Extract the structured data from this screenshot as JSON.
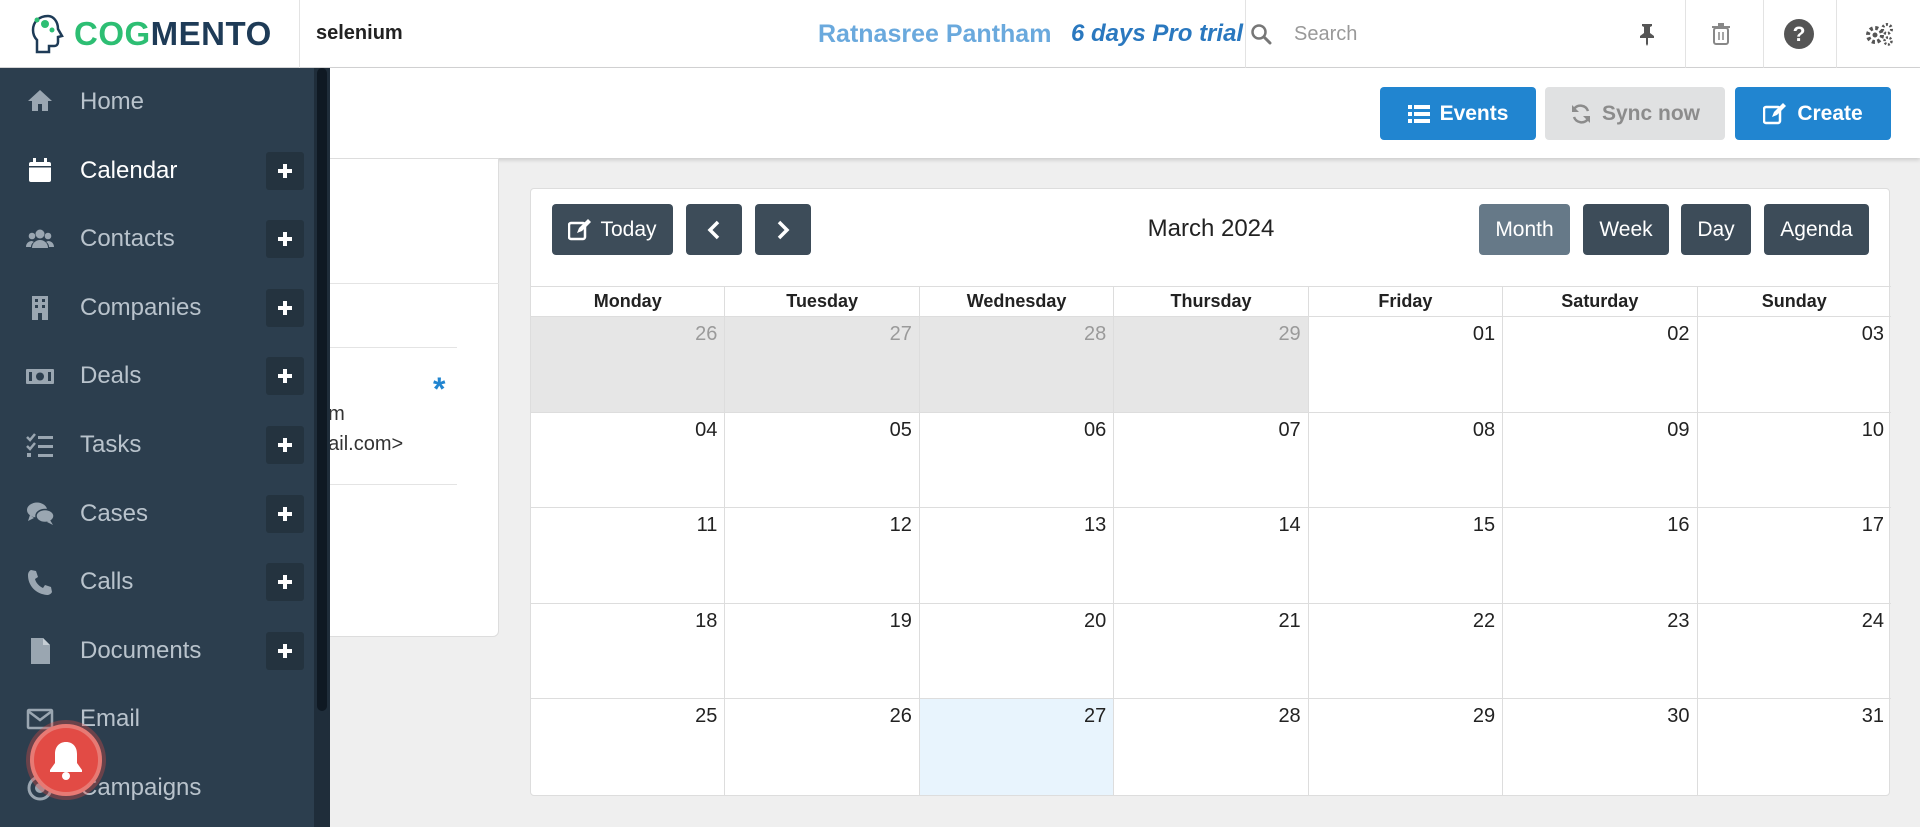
{
  "header": {
    "logo_cog": "COG",
    "logo_mento": "MENTO",
    "tenant": "selenium",
    "user_name": "Ratnasree Pantham",
    "trial": "6 days Pro trial",
    "search_placeholder": "Search",
    "icons": [
      "pin-icon",
      "trash-icon",
      "help-icon",
      "settings-icon"
    ]
  },
  "sidebar": {
    "items": [
      {
        "label": "Home",
        "icon": "home-icon",
        "has_plus": false,
        "active": false
      },
      {
        "label": "Calendar",
        "icon": "calendar-icon",
        "has_plus": true,
        "active": true
      },
      {
        "label": "Contacts",
        "icon": "users-icon",
        "has_plus": true,
        "active": false
      },
      {
        "label": "Companies",
        "icon": "building-icon",
        "has_plus": true,
        "active": false
      },
      {
        "label": "Deals",
        "icon": "money-icon",
        "has_plus": true,
        "active": false
      },
      {
        "label": "Tasks",
        "icon": "tasks-icon",
        "has_plus": true,
        "active": false
      },
      {
        "label": "Cases",
        "icon": "comments-icon",
        "has_plus": true,
        "active": false
      },
      {
        "label": "Calls",
        "icon": "phone-icon",
        "has_plus": true,
        "active": false
      },
      {
        "label": "Documents",
        "icon": "file-icon",
        "has_plus": true,
        "active": false
      },
      {
        "label": "Email",
        "icon": "envelope-icon",
        "has_plus": false,
        "active": false
      },
      {
        "label": "Campaigns",
        "icon": "campaign-icon",
        "has_plus": false,
        "active": false
      }
    ]
  },
  "toolbar": {
    "events_label": "Events",
    "sync_label": "Sync now",
    "create_label": "Create"
  },
  "left_card": {
    "line1": "am",
    "line2": "nail.com>",
    "marker": "*"
  },
  "calendar": {
    "today_label": "Today",
    "title": "March 2024",
    "views": [
      "Month",
      "Week",
      "Day",
      "Agenda"
    ],
    "active_view": "Month",
    "weekdays": [
      "Monday",
      "Tuesday",
      "Wednesday",
      "Thursday",
      "Friday",
      "Saturday",
      "Sunday"
    ],
    "weeks": [
      [
        "26",
        "27",
        "28",
        "29",
        "01",
        "02",
        "03"
      ],
      [
        "04",
        "05",
        "06",
        "07",
        "08",
        "09",
        "10"
      ],
      [
        "11",
        "12",
        "13",
        "14",
        "15",
        "16",
        "17"
      ],
      [
        "18",
        "19",
        "20",
        "21",
        "22",
        "23",
        "24"
      ],
      [
        "25",
        "26",
        "27",
        "28",
        "29",
        "30",
        "31"
      ]
    ],
    "other_month_days": 4,
    "today_cell": "27"
  },
  "colors": {
    "primary": "#2185d0",
    "sidebar_bg": "#2c3e4e",
    "calendar_btn": "#3d4c59",
    "calendar_btn_active": "#667988",
    "today_bg": "#e8f4fd",
    "other_month_bg": "#e6e6e6",
    "bell": "#e24b45"
  }
}
